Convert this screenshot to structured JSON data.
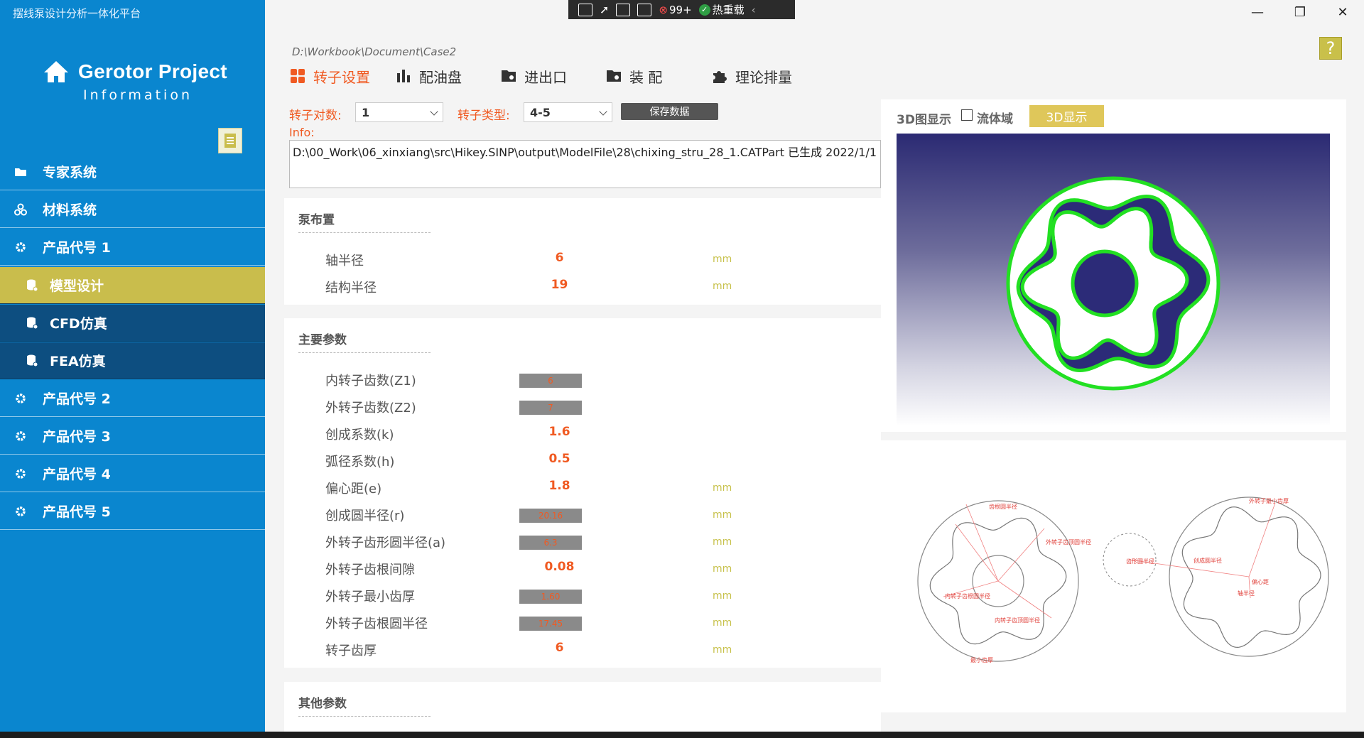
{
  "app": {
    "title": "摆线泵设计分析一体化平台",
    "logo_title": "Gerotor Project",
    "logo_subtitle": "Information"
  },
  "sidebar": {
    "items": [
      {
        "label": "专家系统"
      },
      {
        "label": "材料系统"
      },
      {
        "label": "产品代号 1"
      },
      {
        "label": "模型设计"
      },
      {
        "label": "CFD仿真"
      },
      {
        "label": "FEA仿真"
      },
      {
        "label": "产品代号 2"
      },
      {
        "label": "产品代号 3"
      },
      {
        "label": "产品代号 4"
      },
      {
        "label": "产品代号 5"
      }
    ]
  },
  "toolbar": {
    "badge_count": "99+",
    "hot_reload": "热重载"
  },
  "path": "D:\\Workbook\\Document\\Case2",
  "tabs": [
    {
      "label": "转子设置"
    },
    {
      "label": "配油盘"
    },
    {
      "label": "进出口"
    },
    {
      "label": "装 配"
    },
    {
      "label": "理论排量"
    }
  ],
  "form": {
    "rotor_pairs_label": "转子对数:",
    "rotor_pairs_value": "1",
    "rotor_type_label": "转子类型:",
    "rotor_type_value": "4-5",
    "save_label": "保存数据",
    "info_label": "Info:",
    "info_text": "D:\\00_Work\\06_xinxiang\\src\\Hikey.SINP\\output\\ModelFile\\28\\chixing_stru_28_1.CATPart   已生成   2022/1/1"
  },
  "pump_layout": {
    "title": "泵布置",
    "rows": [
      {
        "name": "轴半径",
        "value": "6",
        "unit": "mm"
      },
      {
        "name": "结构半径",
        "value": "19",
        "unit": "mm"
      }
    ]
  },
  "main_params": {
    "title": "主要参数",
    "rows": [
      {
        "name": "内转子齿数(Z1)",
        "value": "6",
        "unit": ""
      },
      {
        "name": "外转子齿数(Z2)",
        "value": "7",
        "unit": ""
      },
      {
        "name": "创成系数(k)",
        "value": "1.6",
        "unit": ""
      },
      {
        "name": "弧径系数(h)",
        "value": "0.5",
        "unit": ""
      },
      {
        "name": "偏心距(e)",
        "value": "1.8",
        "unit": "mm"
      },
      {
        "name": "创成圆半径(r)",
        "value": "20.16",
        "unit": "mm"
      },
      {
        "name": "外转子齿形圆半径(a)",
        "value": "6.3",
        "unit": "mm"
      },
      {
        "name": "外转子齿根间隙",
        "value": "0.08",
        "unit": "mm"
      },
      {
        "name": "外转子最小齿厚",
        "value": "1.60",
        "unit": "mm"
      },
      {
        "name": "外转子齿根圆半径",
        "value": "17.45",
        "unit": "mm"
      },
      {
        "name": "转子齿厚",
        "value": "6",
        "unit": "mm"
      }
    ]
  },
  "other_params": {
    "title": "其他参数"
  },
  "view3d": {
    "label": "3D图显示",
    "fluid_label": "流体域",
    "show_button": "3D显示"
  },
  "diagram": {
    "left_labels": [
      "内转子齿根圆半径",
      "外转子齿顶圆半径",
      "齿根圆半径",
      "内转子齿顶圆半径",
      "最小齿厚"
    ],
    "right_labels": [
      "外转子最小齿厚",
      "齿形圆半径",
      "创成圆半径",
      "偏心距",
      "轴半径"
    ]
  }
}
